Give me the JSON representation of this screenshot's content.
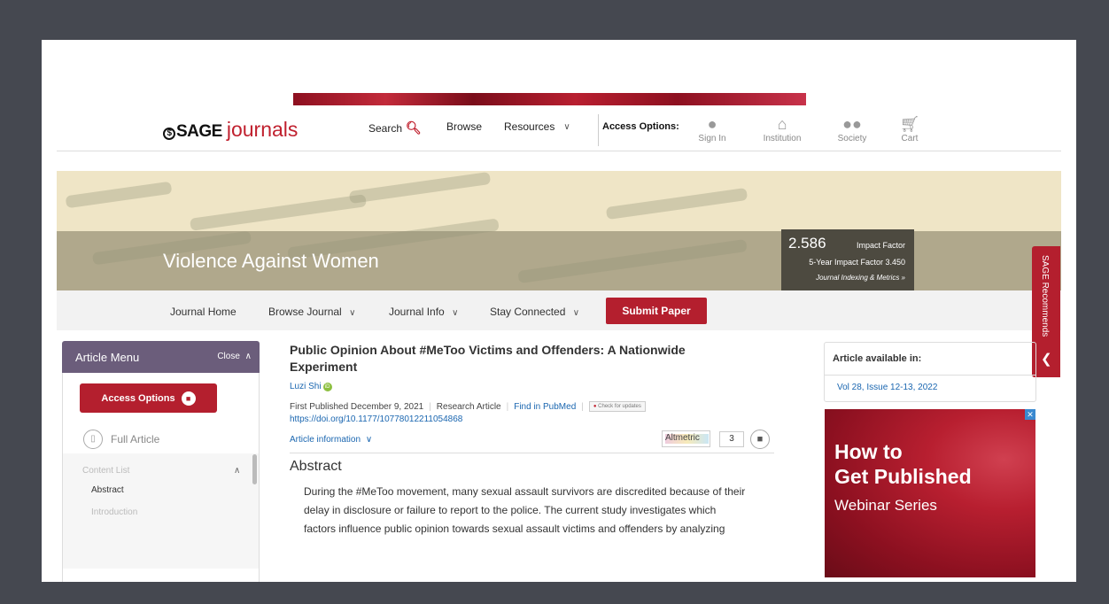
{
  "header": {
    "logo_sage": "SAGE",
    "logo_journals": "journals",
    "search_label": "Search",
    "browse_label": "Browse",
    "resources_label": "Resources",
    "access_options_label": "Access Options:",
    "icons": [
      {
        "label": "Sign In",
        "icon": "person-icon"
      },
      {
        "label": "Institution",
        "icon": "institution-icon"
      },
      {
        "label": "Society",
        "icon": "society-icon"
      },
      {
        "label": "Cart",
        "icon": "cart-icon"
      }
    ]
  },
  "journal": {
    "title": "Violence Against Women",
    "impact_value": "2.586",
    "impact_label": "Impact Factor",
    "five_year": "5-Year Impact Factor 3.450",
    "indexing_link": "Journal Indexing & Metrics »"
  },
  "journal_nav": {
    "home": "Journal Home",
    "browse": "Browse Journal",
    "info": "Journal Info",
    "stay": "Stay Connected",
    "submit": "Submit Paper"
  },
  "recommends": {
    "label": "SAGE Recommends"
  },
  "article_menu": {
    "title": "Article Menu",
    "close_label": "Close",
    "access_button": "Access Options",
    "full_article": "Full Article",
    "content_list_title": "Content List",
    "items": [
      "Abstract",
      "Introduction"
    ]
  },
  "article": {
    "title": "Public Opinion About #MeToo Victims and Offenders: A Nationwide Experiment",
    "author": "Luzi Shi",
    "first_published": "First Published December 9, 2021",
    "type": "Research Article",
    "pubmed": "Find in PubMed",
    "check_updates": "Check for updates",
    "doi": "https://doi.org/10.1177/10778012211054868",
    "info_label": "Article information",
    "altmetric_label": "Altmetric",
    "altmetric_count": "3",
    "abstract_heading": "Abstract",
    "abstract_lines": [
      "During the #MeToo movement, many sexual assault survivors are discredited because of their",
      "delay in disclosure or failure to report to the police. The current study investigates which",
      "factors influence public opinion towards sexual assault victims and offenders by analyzing"
    ]
  },
  "sidebar": {
    "available_title": "Article available in:",
    "available_link": "Vol 28, Issue 12-13, 2022"
  },
  "ad": {
    "line1": "How to",
    "line2": "Get Published",
    "line3": "Webinar Series"
  }
}
